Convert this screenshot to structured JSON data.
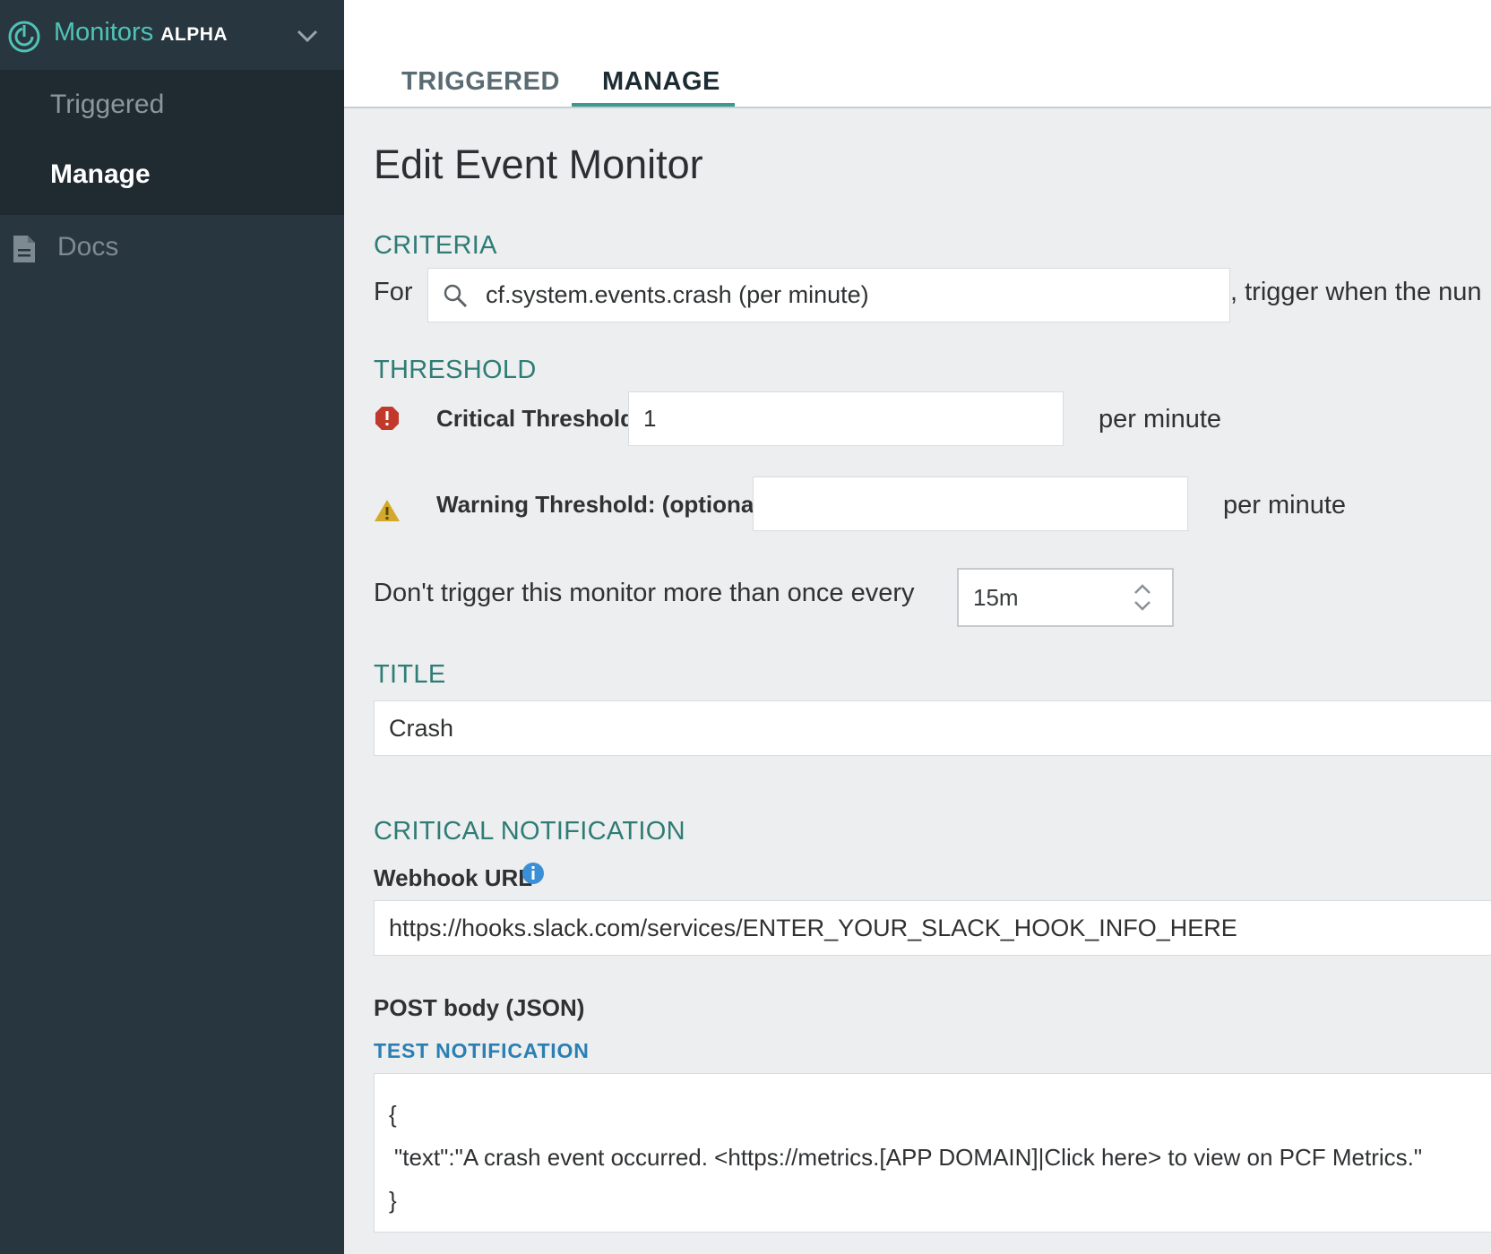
{
  "sidebar": {
    "app_title": "Monitors",
    "app_badge": "ALPHA",
    "items": [
      {
        "label": "Triggered"
      },
      {
        "label": "Manage"
      }
    ],
    "docs_label": "Docs"
  },
  "tabs": [
    {
      "label": "TRIGGERED",
      "active": false
    },
    {
      "label": "MANAGE",
      "active": true
    }
  ],
  "page": {
    "title": "Edit Event Monitor"
  },
  "criteria": {
    "heading": "CRITERIA",
    "for_label": "For",
    "metric_value": "cf.system.events.crash (per minute)",
    "trailing_text": ", trigger when the nun"
  },
  "threshold": {
    "heading": "THRESHOLD",
    "critical_label": "Critical Threshold:",
    "critical_value": "1",
    "critical_unit": "per minute",
    "warning_label": "Warning Threshold: (optional)",
    "warning_value": "",
    "warning_unit": "per minute",
    "throttle_label": "Don't trigger this monitor more than once every",
    "throttle_value": "15m"
  },
  "title_section": {
    "heading": "TITLE",
    "value": "Crash"
  },
  "notification": {
    "heading": "CRITICAL NOTIFICATION",
    "webhook_label": "Webhook URL",
    "webhook_value": "https://hooks.slack.com/services/ENTER_YOUR_SLACK_HOOK_INFO_HERE",
    "post_label": "POST body (JSON)",
    "test_link": "TEST NOTIFICATION",
    "json_lines": [
      "{",
      "\"text\":\"A crash event occurred. <https://metrics.[APP DOMAIN]|Click here> to view on PCF Metrics.\"",
      "}"
    ]
  },
  "colors": {
    "sidebar_bg": "#283640",
    "sidebar_sub_bg": "#1f2a31",
    "accent_teal": "#3a9a92",
    "section_heading": "#2e7c76",
    "link_blue": "#2b7fb3",
    "critical_red": "#c0392b",
    "warning_yellow": "#d4a82a"
  }
}
